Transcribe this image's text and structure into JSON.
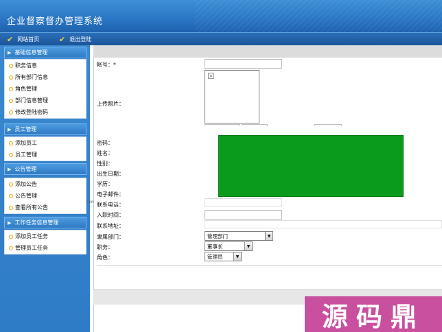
{
  "app": {
    "title": "企业督察督办管理系统"
  },
  "toolbar": {
    "home_label": "网站首页",
    "logout_label": "退出登陆"
  },
  "sidebar": {
    "groups": [
      {
        "title": "基础信息管理",
        "items": [
          "职务信息",
          "所有部门信息",
          "角色管理",
          "部门信息管理",
          "修改登陆密码"
        ]
      },
      {
        "title": "员工管理",
        "items": [
          "添加员工",
          "员工管理"
        ]
      },
      {
        "title": "公告管理",
        "items": [
          "添加公告",
          "公告管理",
          "查看所有公告"
        ]
      },
      {
        "title": "工作任务信息管理",
        "items": [
          "添加员工任务",
          "管理员工任务"
        ]
      }
    ]
  },
  "form": {
    "labels": {
      "account": "帐号：*",
      "photo": "上传照片：",
      "password": "密码：",
      "name": "姓名：",
      "gender": "性别：",
      "birth": "出生日期：",
      "education": "学历：",
      "email": "电子邮件：",
      "phone": "联系电话：",
      "hire_date": "入职时间：",
      "address": "联系地址：",
      "department": "隶属部门：",
      "position": "职务：",
      "role": "角色："
    },
    "values": {
      "department": "管理部门",
      "position": "董事长",
      "role": "管理员"
    }
  },
  "side_note": "con",
  "watermark": {
    "text": "源码鼎",
    "color": "#c8509e"
  },
  "colors": {
    "header": "#2a76c4",
    "sidebar": "#3a88cf",
    "green_block": "#0b9b1c"
  },
  "icons": {
    "toolbar": "checkmark-icon",
    "group": "triangle-right-icon",
    "item": "bullet-ring-icon",
    "select": "chevron-down-icon"
  }
}
